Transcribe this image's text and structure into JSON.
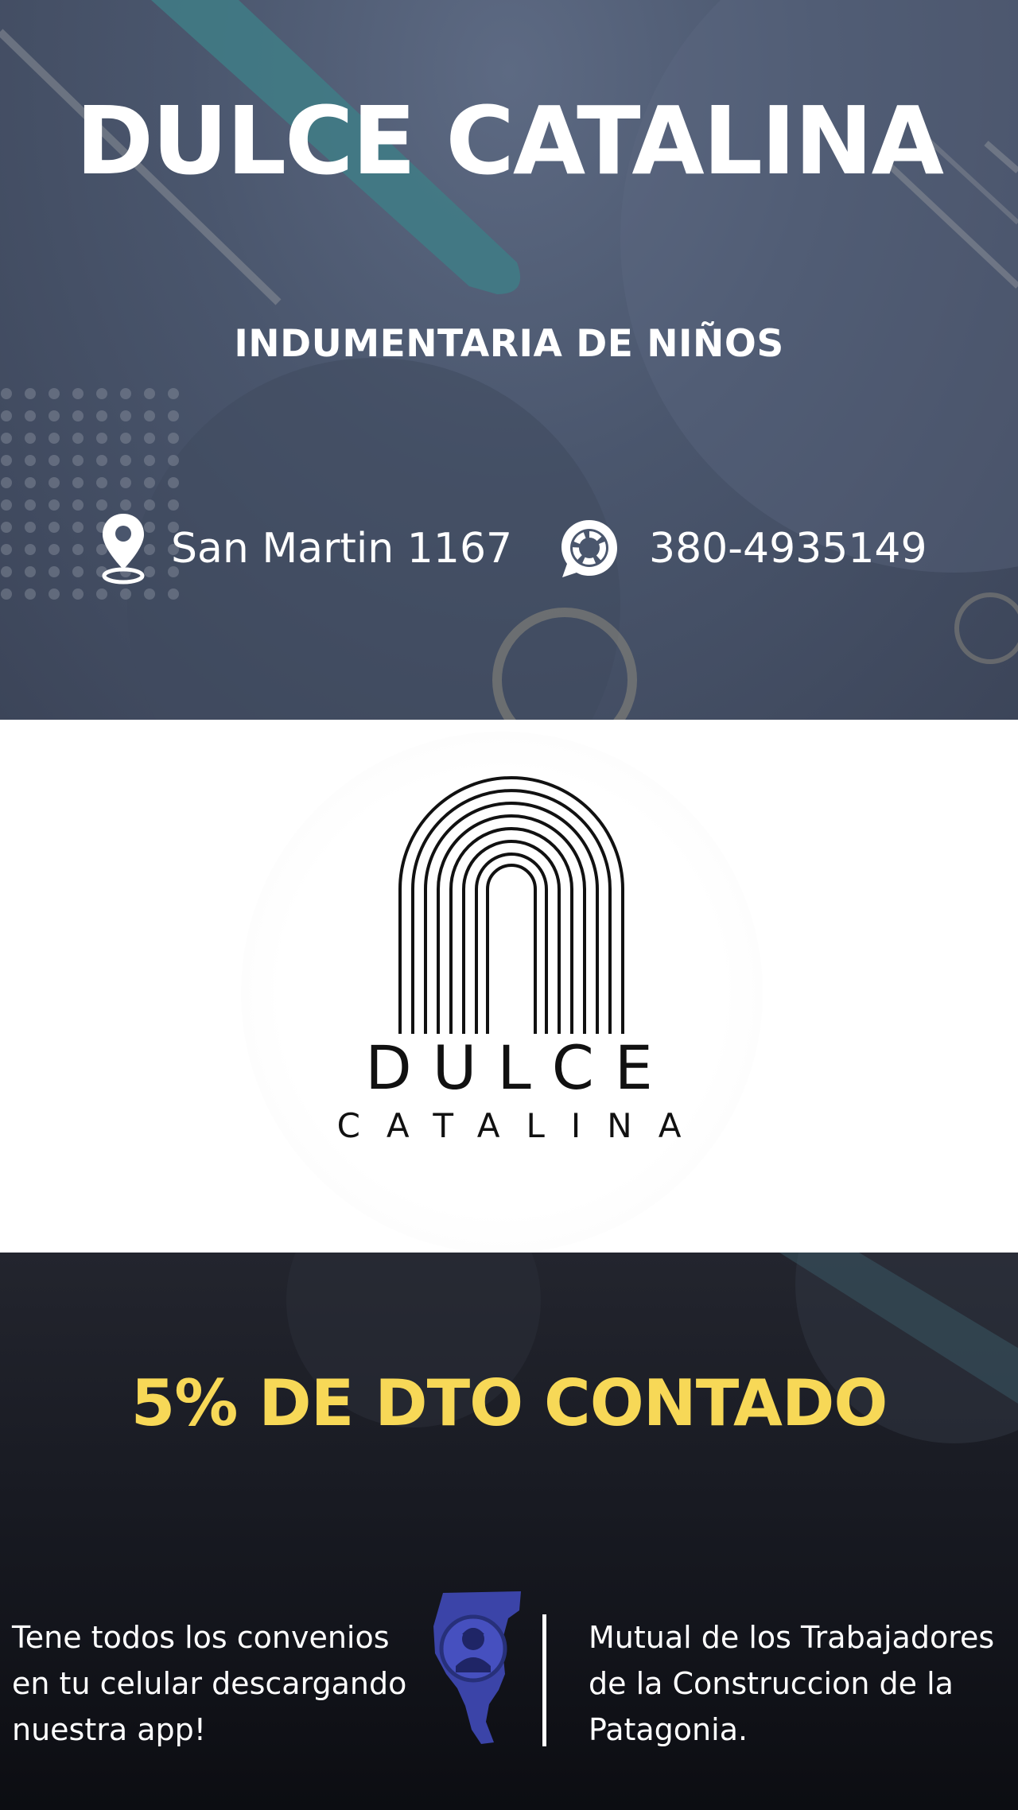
{
  "header": {
    "title": "DULCE CATALINA",
    "subtitle": "INDUMENTARIA DE NIÑOS",
    "address": "San Martin 1167",
    "address_icon": "map-pin-icon",
    "phone": "380-4935149",
    "phone_icon": "whatsapp-icon"
  },
  "logo": {
    "line1": "DULCE",
    "line2": "CATALINA"
  },
  "promo": {
    "title": "5% DE DTO CONTADO",
    "title_color": "#f7d857",
    "app_text": "Tene todos los convenios en tu celular descargando nuestra app!",
    "mutual_text": "Mutual de los Trabajadores de la Construccion de la Patagonia.",
    "mutual_icon": "mutual-patagonia-logo"
  }
}
